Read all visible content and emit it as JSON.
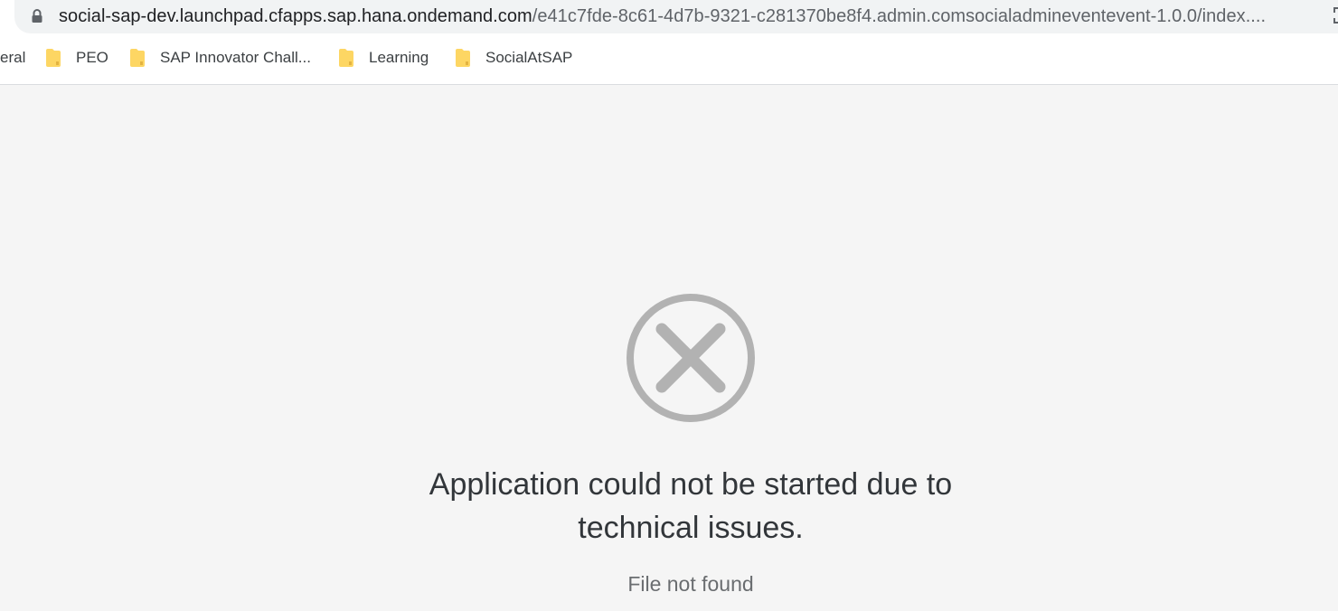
{
  "browser": {
    "url_host": "social-sap-dev.launchpad.cfapps.sap.hana.ondemand.com",
    "url_path": "/e41c7fde-8c61-4d7b-9321-c281370be8f4.admin.comsocialadmineventevent-1.0.0/index...."
  },
  "bookmarks": {
    "partial_label": "eral",
    "items": [
      {
        "label": "PEO",
        "icon": "folder-icon"
      },
      {
        "label": "SAP Innovator Chall...",
        "icon": "folder-icon"
      },
      {
        "label": "Learning",
        "icon": "folder-icon"
      },
      {
        "label": "SocialAtSAP",
        "icon": "folder-icon"
      }
    ]
  },
  "error": {
    "icon": "error-circle-x-icon",
    "title": "Application could not be started due to technical issues.",
    "detail": "File not found"
  },
  "colors": {
    "page_bg": "#f5f5f5",
    "icon_gray": "#b2b2b2",
    "folder_yellow": "#fdd663",
    "title_text": "#32363a",
    "detail_text": "#6a6d70"
  }
}
